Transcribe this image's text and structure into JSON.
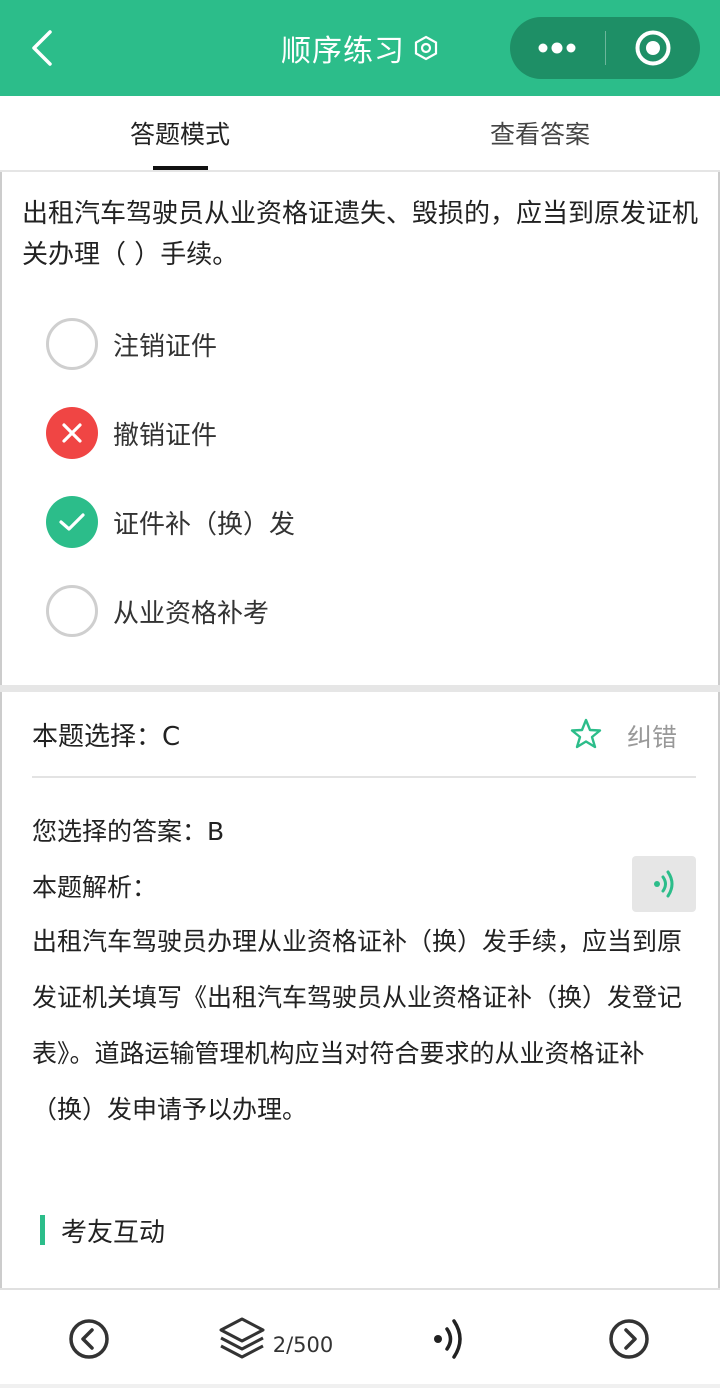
{
  "header": {
    "title": "顺序练习",
    "back_icon": "back-chevron-icon",
    "title_icon": "settings-hex-icon",
    "menu_icon": "more-dots-icon",
    "close_icon": "target-circle-icon",
    "background": "#2cbd8a"
  },
  "tabs": [
    {
      "label": "答题模式",
      "active": true
    },
    {
      "label": "查看答案",
      "active": false
    }
  ],
  "question": {
    "text": "出租汽车驾驶员从业资格证遗失、毁损的，应当到原发证机关办理（ ）手续。",
    "options": [
      {
        "label": "注销证件",
        "state": "unselected"
      },
      {
        "label": "撤销证件",
        "state": "wrong"
      },
      {
        "label": "证件补（换）发",
        "state": "correct"
      },
      {
        "label": "从业资格补考",
        "state": "unselected"
      }
    ]
  },
  "answer": {
    "correct_line": "本题选择：C",
    "favorite_icon": "star-icon",
    "report_label": "纠错",
    "your_answer": "您选择的答案：B",
    "analysis_label": "本题解析：",
    "audio_icon": "audio-wave-icon",
    "analysis_text": "出租汽车驾驶员办理从业资格证补（换）发手续，应当到原发证机关填写《出租汽车驾驶员从业资格证补（换）发登记表》。道路运输管理机构应当对符合要求的从业资格证补（换）发申请予以办理。"
  },
  "community": {
    "title": "考友互动"
  },
  "bottom_bar": {
    "prev_icon": "prev-circle-icon",
    "list_icon": "layers-icon",
    "progress": "2/500",
    "audio_icon": "audio-wave-icon",
    "next_icon": "next-circle-icon"
  },
  "colors": {
    "accent": "#2cbd8a",
    "wrong": "#f04544",
    "capsule": "#1e8f66"
  }
}
